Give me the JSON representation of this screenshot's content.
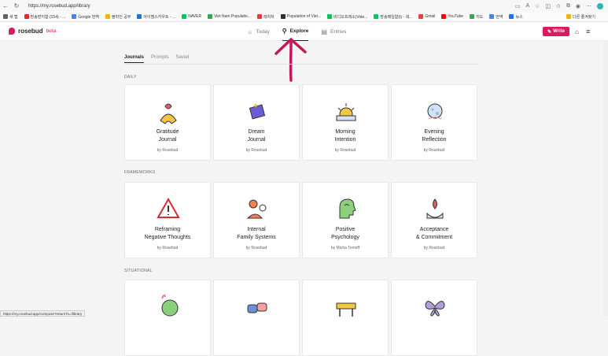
{
  "browser": {
    "url": "https://my.rosebud.app/library",
    "bookmarks": [
      {
        "label": "새 탭",
        "color": "#5f6368"
      },
      {
        "label": "방송편지함 (154) - ...",
        "color": "#d93025"
      },
      {
        "label": "Google 번역",
        "color": "#4285f4"
      },
      {
        "label": "블라인 공부",
        "color": "#f4b400"
      },
      {
        "label": "아이캠스카우트 - ...",
        "color": "#1a73e8"
      },
      {
        "label": "NAVER",
        "color": "#03c75a"
      },
      {
        "label": "Viet Nam Populatio...",
        "color": "#34a853"
      },
      {
        "label": "레처처",
        "color": "#e53935"
      },
      {
        "label": "Population of Viet...",
        "color": "#263238"
      },
      {
        "label": "비디오프레소(Vide...",
        "color": "#00c853"
      },
      {
        "label": "방송메일함(t) - 네...",
        "color": "#03c75a"
      },
      {
        "label": "Gmail",
        "color": "#ea4335"
      },
      {
        "label": "YouTube",
        "color": "#ff0000"
      },
      {
        "label": "지도",
        "color": "#34a853"
      },
      {
        "label": "번역",
        "color": "#4285f4"
      },
      {
        "label": "뉴스",
        "color": "#1a73e8"
      }
    ],
    "other_bookmarks": "다른 즐겨찾기",
    "status_url": "https://my.rosebud.app/compose?returnTo=/library"
  },
  "header": {
    "logo": "rosebud",
    "beta": "beta",
    "tabs": [
      {
        "label": "Today",
        "icon": "sun-icon"
      },
      {
        "label": "Explore",
        "icon": "explore-icon"
      },
      {
        "label": "Entries",
        "icon": "book-icon"
      }
    ],
    "write": "Write"
  },
  "library": {
    "tabs": [
      "Journals",
      "Prompts",
      "Saved"
    ],
    "sections": [
      {
        "label": "DAILY",
        "cards": [
          {
            "title": "Gratitude\nJournal",
            "by": "by Rosebud",
            "icon": "gratitude-icon"
          },
          {
            "title": "Dream\nJournal",
            "by": "by Rosebud",
            "icon": "dream-icon"
          },
          {
            "title": "Morning\nIntention",
            "by": "by Rosebud",
            "icon": "sunrise-icon"
          },
          {
            "title": "Evening\nReflection",
            "by": "by Rosebud",
            "icon": "moon-icon"
          }
        ]
      },
      {
        "label": "FRAMEWORKS",
        "cards": [
          {
            "title": "Reframing\nNegative Thoughts",
            "by": "by Rosebud",
            "icon": "warning-icon"
          },
          {
            "title": "Internal\nFamily Systems",
            "by": "by Rosebud",
            "icon": "family-systems-icon"
          },
          {
            "title": "Positive\nPsychology",
            "by": "by Micha Tomoff",
            "icon": "head-icon"
          },
          {
            "title": "Acceptance\n& Commitment",
            "by": "by Rosebud",
            "icon": "lotus-hand-icon"
          }
        ]
      },
      {
        "label": "SITUATIONAL",
        "cards": [
          {
            "title": "",
            "by": "",
            "icon": "chat-icon"
          },
          {
            "title": "",
            "by": "",
            "icon": "fist-bump-icon"
          },
          {
            "title": "",
            "by": "",
            "icon": "barrier-icon"
          },
          {
            "title": "",
            "by": "",
            "icon": "butterfly-icon"
          }
        ]
      }
    ]
  },
  "colors": {
    "brand": "#d81b60",
    "background": "#f4f4f4",
    "card": "#ffffff"
  }
}
